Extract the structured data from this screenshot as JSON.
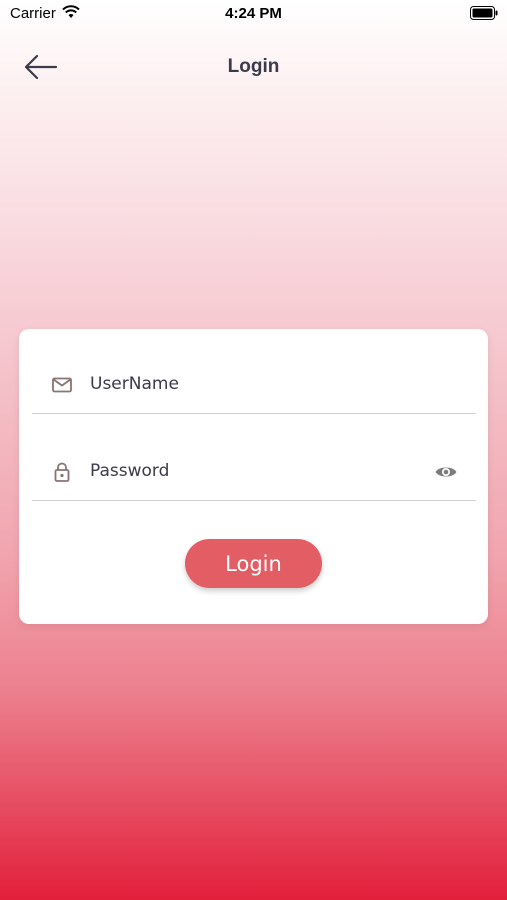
{
  "status_bar": {
    "carrier": "Carrier",
    "time": "4:24 PM"
  },
  "header": {
    "title": "Login",
    "back_icon": "arrow-left-icon"
  },
  "form": {
    "username": {
      "placeholder": "UserName",
      "value": "",
      "icon": "mail-icon"
    },
    "password": {
      "placeholder": "Password",
      "value": "",
      "icon": "lock-icon",
      "toggle_icon": "eye-icon"
    },
    "login_label": "Login"
  },
  "colors": {
    "button": "#e35d64",
    "gradient_bottom": "#e31f3b",
    "text": "#3a3a4a"
  }
}
